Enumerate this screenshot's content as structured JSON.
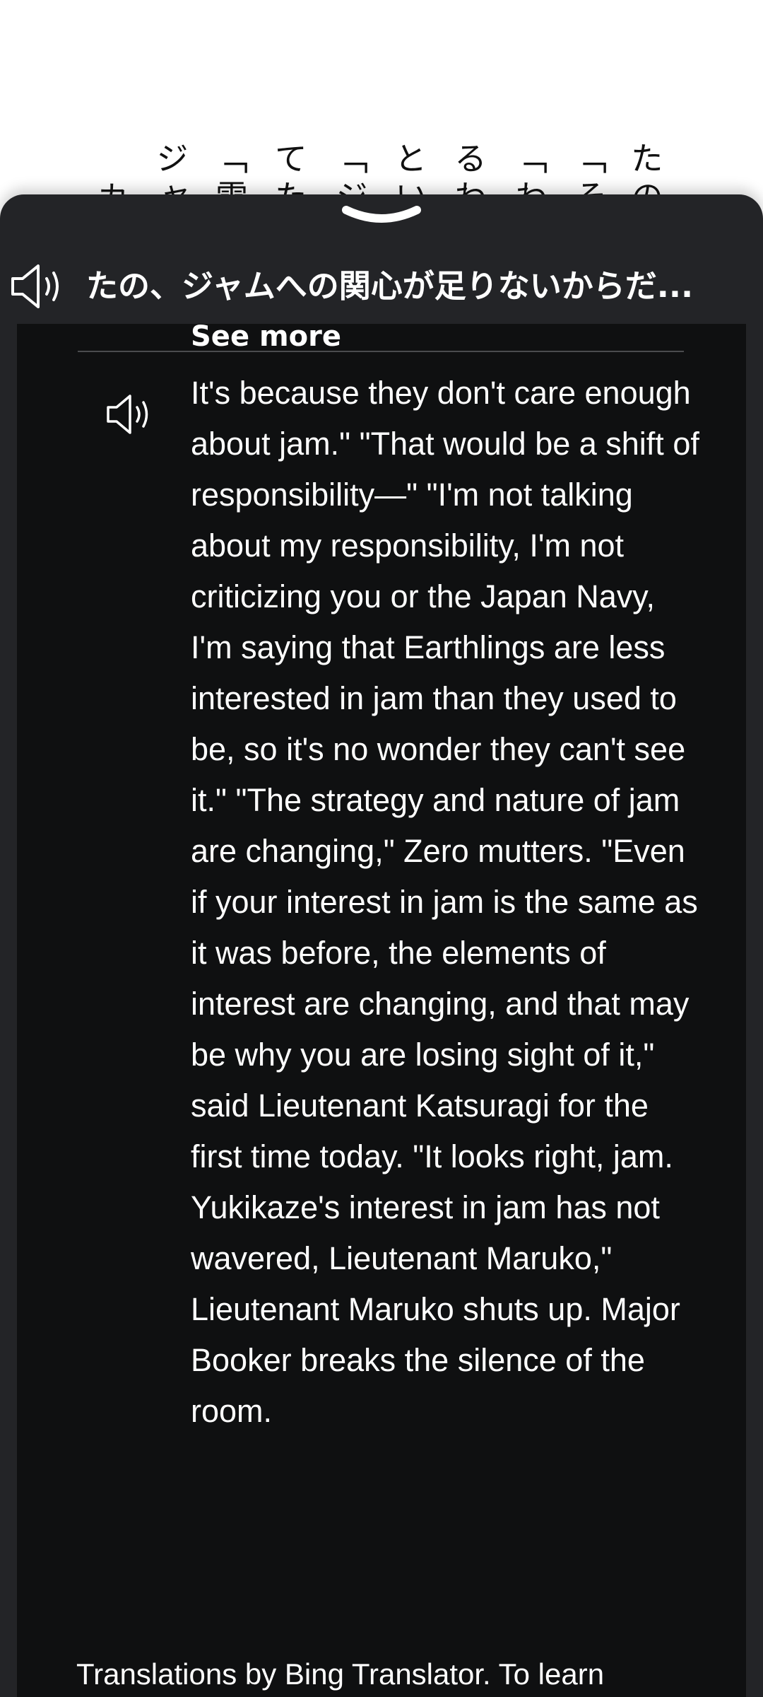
{
  "background_columns": [
    "たの",
    "「そ",
    "「わ",
    "るわ",
    "とい",
    "「ジ",
    "てた",
    "「雪",
    "ジャ",
    "カ"
  ],
  "sheet": {
    "header_text": "たの、ジャムへの関心が足りないからだ...",
    "see_more_label": "See more",
    "translation_text": "It's because they don't care enough about jam.\" \"That would be a shift of responsibility—\" \"I'm not talking about my responsibility, I'm not criticizing you or the Japan Navy, I'm saying that Earthlings are less interested in jam than they used to be, so it's no wonder they can't see it.\" \"The strategy and nature of jam are changing,\" Zero mutters. \"Even if your interest in jam is the same as it was before, the elements of interest are changing, and that may be why you are losing sight of it,\" said Lieutenant Katsuragi for the first time today. \"It looks right, jam. Yukikaze's interest in jam has not wavered, Lieutenant Maruko,\" Lieutenant Maruko shuts up. Major Booker breaks the silence of the room.",
    "footer_note": "Translations by Bing Translator. To learn"
  },
  "icons": {
    "handle": "chevron-down-icon",
    "header_speaker": "speaker-icon",
    "body_speaker": "speaker-icon"
  },
  "colors": {
    "sheet_bg": "#232427",
    "panel_bg": "#0f1011",
    "text": "#ffffff",
    "divider": "#4a4b4e"
  }
}
